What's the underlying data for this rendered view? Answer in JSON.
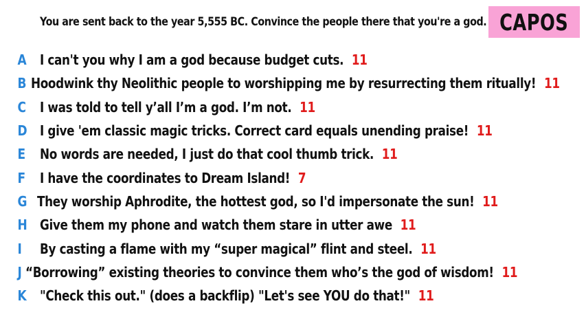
{
  "prompt": "You are sent back to the year 5,555 BC. Convince the people there that you're a god.",
  "badge": "CAPOS",
  "colors": {
    "letter": "#2a86d8",
    "score": "#e01b1b",
    "badge_bg": "#f9a3d6"
  },
  "answers": [
    {
      "letter": "A",
      "text": "I can't you why I am a god because budget cuts.",
      "score": "11"
    },
    {
      "letter": "B",
      "text": "Hoodwink thy Neolithic people to worshipping me by resurrecting them ritually!",
      "score": "11"
    },
    {
      "letter": "C",
      "text": "I was told to tell y’all I’m a god. I’m not.",
      "score": "11"
    },
    {
      "letter": "D",
      "text": "I give 'em classic magic tricks. Correct card equals unending praise!",
      "score": "11"
    },
    {
      "letter": "E",
      "text": "No words are needed, I just do that cool thumb trick.",
      "score": "11"
    },
    {
      "letter": "F",
      "text": "I have the coordinates to Dream Island!",
      "score": "7"
    },
    {
      "letter": "G",
      "text": "They worship Aphrodite, the hottest god, so I'd impersonate the sun!",
      "score": "11"
    },
    {
      "letter": "H",
      "text": "Give them my phone and watch them stare in utter awe",
      "score": "11"
    },
    {
      "letter": "I",
      "text": "By casting a flame with my “super magical” flint and steel.",
      "score": "11"
    },
    {
      "letter": "J",
      "text": "“Borrowing” existing theories to convince them who’s the god of wisdom!",
      "score": "11"
    },
    {
      "letter": "K",
      "text": "\"Check this out.\" (does a backflip) \"Let's see YOU do that!\"",
      "score": "11"
    }
  ]
}
